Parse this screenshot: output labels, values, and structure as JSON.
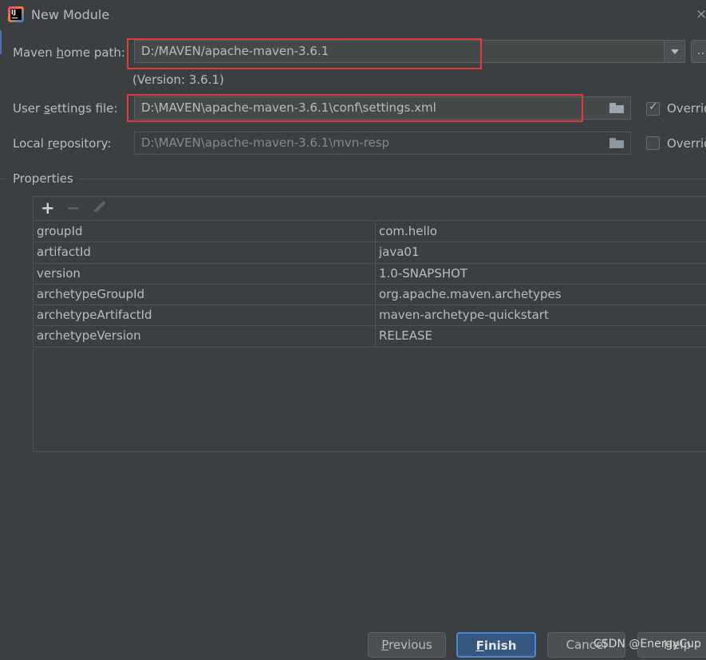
{
  "window": {
    "title": "New Module",
    "close_glyph": "×"
  },
  "maven": {
    "home_label_pre": "Maven ",
    "home_label_mnemonic": "h",
    "home_label_post": "ome path:",
    "home_value": "D:/MAVEN/apache-maven-3.6.1",
    "browse_label": "...",
    "version": "(Version: 3.6.1)",
    "settings_label_pre": "User ",
    "settings_label_mnemonic": "s",
    "settings_label_post": "ettings file:",
    "settings_value": "D:\\MAVEN\\apache-maven-3.6.1\\conf\\settings.xml",
    "settings_override_checked": true,
    "settings_override_label": "Overrid",
    "repo_label_pre": "Local ",
    "repo_label_mnemonic": "r",
    "repo_label_post": "epository:",
    "repo_value": "D:\\MAVEN\\apache-maven-3.6.1\\mvn-resp",
    "repo_override_checked": false,
    "repo_override_label": "Overrid"
  },
  "properties": {
    "title": "Properties",
    "toolbar": {
      "add": "+",
      "remove": "−"
    },
    "rows": [
      {
        "key": "groupId",
        "value": "com.hello"
      },
      {
        "key": "artifactId",
        "value": "java01"
      },
      {
        "key": "version",
        "value": "1.0-SNAPSHOT"
      },
      {
        "key": "archetypeGroupId",
        "value": "org.apache.maven.archetypes"
      },
      {
        "key": "archetypeArtifactId",
        "value": "maven-archetype-quickstart"
      },
      {
        "key": "archetypeVersion",
        "value": "RELEASE"
      }
    ]
  },
  "buttons": {
    "previous_mnemonic": "P",
    "previous_rest": "revious",
    "finish_mnemonic": "F",
    "finish_rest": "inish",
    "cancel": "Cancel",
    "help": "Help"
  },
  "watermark": "CSDN @EnergyCup",
  "colors": {
    "highlight_box": "#e03a3a",
    "default_button": "#365880",
    "background": "#3c3f41"
  }
}
